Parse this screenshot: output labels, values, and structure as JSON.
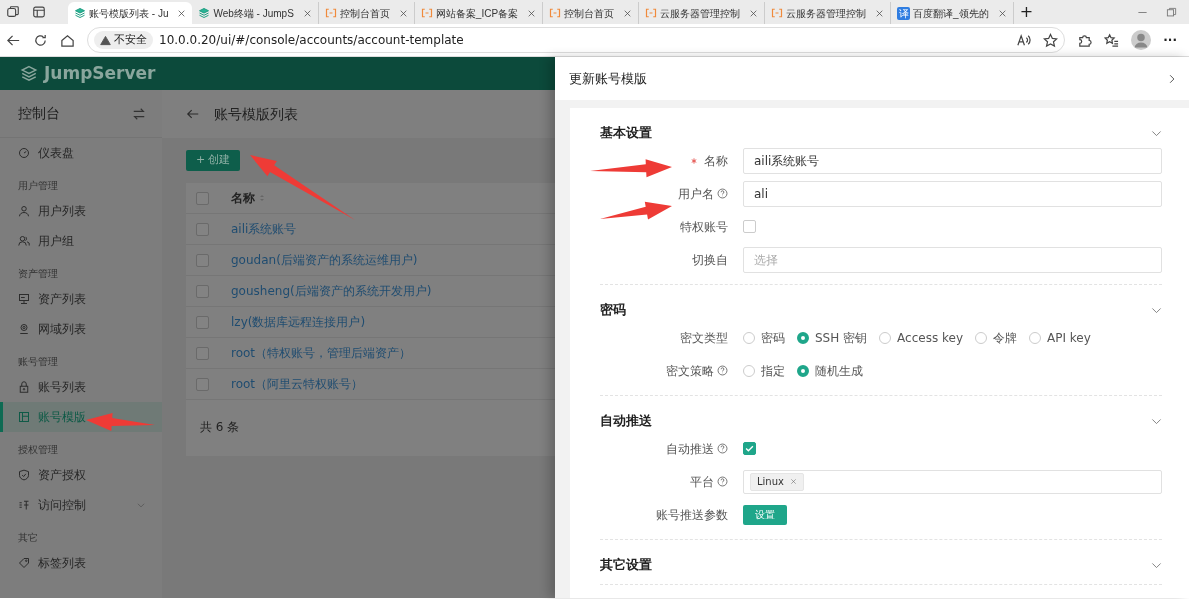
{
  "browser": {
    "tabs": [
      {
        "title": "账号模版列表 - Ju",
        "kind": "jumpserver",
        "selected": true
      },
      {
        "title": "Web终端 - JumpS",
        "kind": "jumpserver",
        "selected": false
      },
      {
        "title": "控制台首页",
        "kind": "cloud",
        "selected": false
      },
      {
        "title": "网站备案_ICP备案",
        "kind": "cloud",
        "selected": false
      },
      {
        "title": "控制台首页",
        "kind": "cloud",
        "selected": false
      },
      {
        "title": "云服务器管理控制",
        "kind": "cloud",
        "selected": false
      },
      {
        "title": "云服务器管理控制",
        "kind": "cloud",
        "selected": false
      },
      {
        "title": "百度翻译_领先的",
        "kind": "translate",
        "selected": false
      }
    ],
    "translate_glyph": "译",
    "new_tab": "+",
    "security_label": "不安全",
    "url": "10.0.0.20/ui/#/console/accounts/account-template",
    "more": "···"
  },
  "app": {
    "logo": "JumpServer",
    "sidebar": {
      "title": "控制台",
      "items": [
        {
          "kind": "item",
          "label": "仪表盘",
          "selected": false
        },
        {
          "kind": "group",
          "label": "用户管理"
        },
        {
          "kind": "item",
          "label": "用户列表",
          "selected": false
        },
        {
          "kind": "item",
          "label": "用户组",
          "selected": false
        },
        {
          "kind": "group",
          "label": "资产管理"
        },
        {
          "kind": "item",
          "label": "资产列表",
          "selected": false
        },
        {
          "kind": "item",
          "label": "网域列表",
          "selected": false
        },
        {
          "kind": "group",
          "label": "账号管理"
        },
        {
          "kind": "item",
          "label": "账号列表",
          "selected": false
        },
        {
          "kind": "item",
          "label": "账号模版",
          "selected": true
        },
        {
          "kind": "group",
          "label": "授权管理"
        },
        {
          "kind": "item",
          "label": "资产授权",
          "selected": false
        },
        {
          "kind": "item",
          "label": "访问控制",
          "selected": false,
          "expandable": true
        },
        {
          "kind": "group",
          "label": "其它"
        },
        {
          "kind": "item",
          "label": "标签列表",
          "selected": false
        }
      ]
    },
    "page": {
      "title": "账号模版列表",
      "create_button": {
        "icon": "+",
        "label": "创建"
      },
      "table": {
        "select_all_checked": false,
        "columns": [
          "名称"
        ],
        "rows": [
          {
            "name": "aili系统账号",
            "checked": false
          },
          {
            "name": "goudan(后端资产的系统运维用户)",
            "checked": false
          },
          {
            "name": "gousheng(后端资产的系统开发用户)",
            "checked": false
          },
          {
            "name": "lzy(数据库远程连接用户)",
            "checked": false
          },
          {
            "name": "root（特权账号，管理后端资产）",
            "checked": false
          },
          {
            "name": "root（阿里云特权账号）",
            "checked": false
          }
        ],
        "total": "共 6 条"
      }
    }
  },
  "drawer": {
    "title": "更新账号模版",
    "sections": [
      {
        "title": "基本设置",
        "fields": [
          {
            "label": "名称",
            "kind": "text",
            "required": true,
            "help": false,
            "value": "aili系统账号"
          },
          {
            "label": "用户名",
            "kind": "text",
            "required": false,
            "help": true,
            "value": "ali"
          },
          {
            "label": "特权账号",
            "kind": "checkbox",
            "required": false,
            "help": false,
            "checked": false
          },
          {
            "label": "切换自",
            "kind": "select",
            "required": false,
            "help": false,
            "placeholder": "选择"
          }
        ]
      },
      {
        "title": "密码",
        "fields": [
          {
            "label": "密文类型",
            "kind": "radio",
            "required": false,
            "help": false,
            "options": [
              {
                "label": "密码",
                "selected": false
              },
              {
                "label": "SSH 密钥",
                "selected": true
              },
              {
                "label": "Access key",
                "selected": false
              },
              {
                "label": "令牌",
                "selected": false
              },
              {
                "label": "API key",
                "selected": false
              }
            ]
          },
          {
            "label": "密文策略",
            "kind": "radio",
            "required": false,
            "help": true,
            "options": [
              {
                "label": "指定",
                "selected": false
              },
              {
                "label": "随机生成",
                "selected": true
              }
            ]
          }
        ]
      },
      {
        "title": "自动推送",
        "fields": [
          {
            "label": "自动推送",
            "kind": "checkbox",
            "required": false,
            "help": true,
            "checked": true
          },
          {
            "label": "平台",
            "kind": "tags",
            "required": false,
            "help": true,
            "tags": [
              "Linux"
            ]
          },
          {
            "label": "账号推送参数",
            "kind": "button",
            "required": false,
            "help": false,
            "button": "设置"
          }
        ]
      },
      {
        "title": "其它设置"
      }
    ]
  }
}
